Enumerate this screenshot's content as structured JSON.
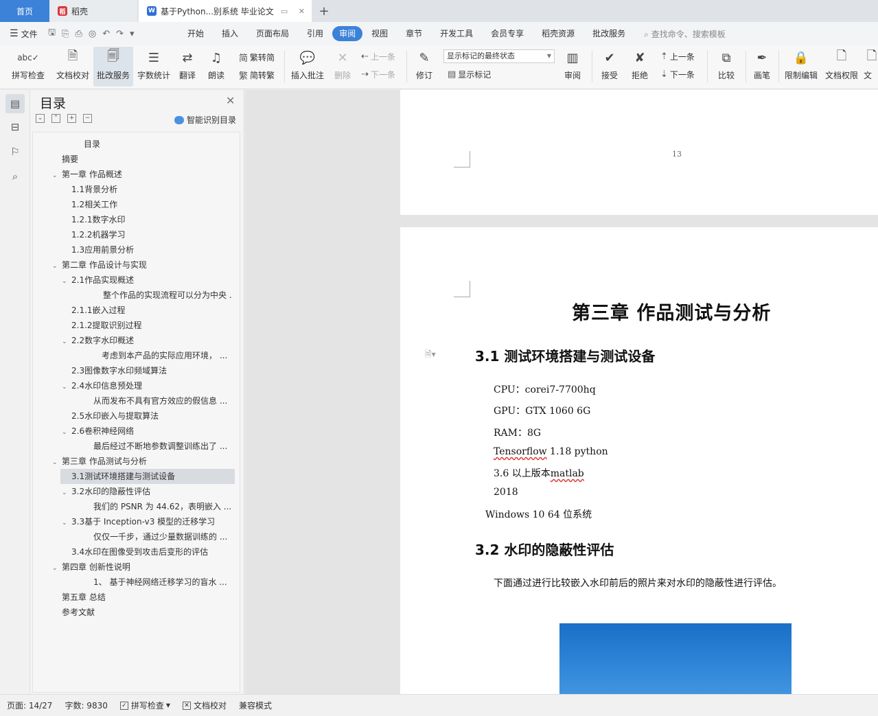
{
  "tabs": {
    "home": "首页",
    "daoke": "稻壳",
    "doc": "基于Python...别系统 毕业论文",
    "add": "+"
  },
  "menu": {
    "file": "文件",
    "tabs": [
      "开始",
      "插入",
      "页面布局",
      "引用",
      "审阅",
      "视图",
      "章节",
      "开发工具",
      "会员专享",
      "稻壳资源",
      "批改服务"
    ],
    "active": "审阅",
    "search": "查找命令、搜索模板"
  },
  "ribbon": {
    "spell": "拼写检查",
    "proofread": "文档校对",
    "revise_service": "批改服务",
    "word_count": "字数统计",
    "translate": "翻译",
    "read_aloud": "朗读",
    "trad_to_simp": "繁转简",
    "simp_to_trad": "简转繁",
    "insert_comment": "插入批注",
    "delete": "删除",
    "prev_comment": "上一条",
    "next_comment": "下一条",
    "track": "修订",
    "markup_state": "显示标记的最终状态",
    "show_markup": "显示标记",
    "review": "审阅",
    "accept": "接受",
    "reject": "拒绝",
    "prev_change": "上一条",
    "next_change": "下一条",
    "compare": "比较",
    "pen": "画笔",
    "restrict_edit": "限制编辑",
    "doc_permission": "文档权限",
    "doc_more": "文"
  },
  "toc": {
    "title": "目录",
    "smart": "智能识别目录",
    "items": [
      {
        "text": "目录",
        "level": 0,
        "chev": ""
      },
      {
        "text": "摘要",
        "level": 1,
        "chev": ""
      },
      {
        "text": "第一章 作品概述",
        "level": 1,
        "chev": "v"
      },
      {
        "text": "1.1背景分析",
        "level": 2,
        "chev": ""
      },
      {
        "text": "1.2相关工作",
        "level": 2,
        "chev": ""
      },
      {
        "text": "1.2.1数字水印",
        "level": 2,
        "chev": ""
      },
      {
        "text": "1.2.2机器学习",
        "level": 2,
        "chev": ""
      },
      {
        "text": "1.3应用前景分析",
        "level": 2,
        "chev": ""
      },
      {
        "text": "第二章 作品设计与实现",
        "level": 1,
        "chev": "v"
      },
      {
        "text": "2.1作品实现概述",
        "level": 2,
        "chev": "v"
      },
      {
        "text": "整个作品的实现流程可以分为中央 ...",
        "level": 4,
        "chev": ""
      },
      {
        "text": "2.1.1嵌入过程",
        "level": 2,
        "chev": ""
      },
      {
        "text": "2.1.2提取识别过程",
        "level": 2,
        "chev": ""
      },
      {
        "text": "2.2数字水印概述",
        "level": 2,
        "chev": "v"
      },
      {
        "text": "考虑到本产品的实际应用环境，  ...",
        "level": 5,
        "chev": ""
      },
      {
        "text": "2.3图像数字水印频域算法",
        "level": 2,
        "chev": ""
      },
      {
        "text": "2.4水印信息预处理",
        "level": 2,
        "chev": "v"
      },
      {
        "text": "从而发布不具有官方效应的假信息 ...",
        "level": 3,
        "chev": ""
      },
      {
        "text": "2.5水印嵌入与提取算法",
        "level": 2,
        "chev": ""
      },
      {
        "text": "2.6卷积神经网络",
        "level": 2,
        "chev": "v"
      },
      {
        "text": "最后经过不断地参数调整训练出了 ...",
        "level": 3,
        "chev": ""
      },
      {
        "text": "第三章 作品测试与分析",
        "level": 1,
        "chev": "v"
      },
      {
        "text": "3.1测试环境搭建与测试设备",
        "level": 2,
        "chev": "",
        "selected": true
      },
      {
        "text": "3.2水印的隐蔽性评估",
        "level": 2,
        "chev": "v"
      },
      {
        "text": "我们的 PSNR 为 44.62，表明嵌入 ...",
        "level": 3,
        "chev": ""
      },
      {
        "text": "3.3基于 Inception-v3 模型的迁移学习",
        "level": 2,
        "chev": "v"
      },
      {
        "text": "仅仅一千步，通过少量数据训练的 ...",
        "level": 3,
        "chev": ""
      },
      {
        "text": "3.4水印在图像受到攻击后变形的评估",
        "level": 2,
        "chev": ""
      },
      {
        "text": "第四章 创新性说明",
        "level": 1,
        "chev": "v"
      },
      {
        "text": "1、 基于神经网络迁移学习的盲水 ...",
        "level": 3,
        "chev": ""
      },
      {
        "text": "第五章 总结",
        "level": 1,
        "chev": ""
      },
      {
        "text": "参考文献",
        "level": 1,
        "chev": ""
      }
    ]
  },
  "document": {
    "page_number": "13",
    "chapter_title": "第三章 作品测试与分析",
    "section1": "3.1  测试环境搭建与测试设备",
    "lines": {
      "cpu": "CPU：corei7-7700hq",
      "gpu": "GPU：GTX 1060 6G",
      "ram": "RAM：8G",
      "tf_a": "Tensorflow",
      "tf_b": " 1.18 python",
      "py_a": "3.6 以上版本",
      "py_b": "matlab",
      "year": "2018",
      "os": "Windows 10 64 位系统"
    },
    "section2": "3.2  水印的隐蔽性评估",
    "para2": "下面通过进行比较嵌入水印前后的照片来对水印的隐蔽性进行评估。"
  },
  "status": {
    "page": "页面: 14/27",
    "words": "字数: 9830",
    "spell": "拼写检查",
    "proof": "文档校对",
    "compat": "兼容模式"
  },
  "colors": {
    "accent": "#3b82d8",
    "wps_red": "#d9363e",
    "wps_blue": "#2f6fd6"
  }
}
